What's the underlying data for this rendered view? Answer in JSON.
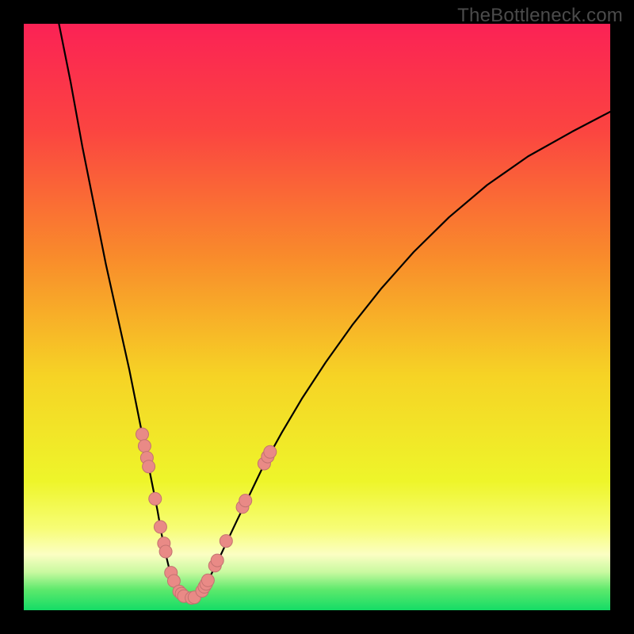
{
  "watermark": "TheBottleneck.com",
  "colors": {
    "frame_bg": "#000000",
    "curve_stroke": "#000000",
    "marker_fill": "#e98a86",
    "marker_stroke": "#c37270",
    "gradient_stops": [
      {
        "offset": 0.0,
        "color": "#fb2255"
      },
      {
        "offset": 0.18,
        "color": "#fb4441"
      },
      {
        "offset": 0.4,
        "color": "#f98c2b"
      },
      {
        "offset": 0.6,
        "color": "#f6d325"
      },
      {
        "offset": 0.78,
        "color": "#eef52a"
      },
      {
        "offset": 0.86,
        "color": "#f7fd75"
      },
      {
        "offset": 0.905,
        "color": "#fbfec3"
      },
      {
        "offset": 0.935,
        "color": "#c9f9a0"
      },
      {
        "offset": 0.965,
        "color": "#5de96c"
      },
      {
        "offset": 1.0,
        "color": "#14dc66"
      }
    ]
  },
  "chart_data": {
    "type": "line",
    "title": "",
    "xlabel": "",
    "ylabel": "",
    "xlim": [
      0,
      100
    ],
    "ylim": [
      0,
      100
    ],
    "grid": false,
    "series": [
      {
        "name": "bottleneck-curve-left",
        "x": [
          6,
          8,
          10,
          12,
          14,
          16,
          18,
          19,
          20,
          21,
          22,
          22.8,
          23.5,
          24.1,
          24.7,
          25.3,
          25.9,
          26.5
        ],
        "y": [
          100,
          90,
          79,
          69,
          59,
          50,
          41,
          36,
          31,
          26,
          21,
          17,
          13,
          10,
          7.5,
          5.5,
          4,
          3
        ]
      },
      {
        "name": "bottleneck-curve-bottom",
        "x": [
          26.5,
          27.2,
          28,
          28.8,
          29.6,
          30.2
        ],
        "y": [
          3,
          2.3,
          2,
          2,
          2.3,
          3
        ]
      },
      {
        "name": "bottleneck-curve-right",
        "x": [
          30.2,
          31,
          32,
          33.2,
          34.6,
          36.4,
          38.6,
          41,
          44,
          47.5,
          51.5,
          56,
          61,
          66.5,
          72.5,
          79,
          86,
          93.5,
          100
        ],
        "y": [
          3,
          4.3,
          6.2,
          8.6,
          11.6,
          15.4,
          19.9,
          24.9,
          30.3,
          36.2,
          42.3,
          48.6,
          54.9,
          61.1,
          67,
          72.5,
          77.4,
          81.6,
          85
        ]
      }
    ],
    "markers": [
      {
        "x": 20.2,
        "y": 30.0
      },
      {
        "x": 20.6,
        "y": 28.0
      },
      {
        "x": 21.0,
        "y": 26.0
      },
      {
        "x": 21.3,
        "y": 24.5
      },
      {
        "x": 22.4,
        "y": 19.0
      },
      {
        "x": 23.3,
        "y": 14.2
      },
      {
        "x": 23.9,
        "y": 11.4
      },
      {
        "x": 24.2,
        "y": 10.0
      },
      {
        "x": 25.1,
        "y": 6.4
      },
      {
        "x": 25.6,
        "y": 5.0
      },
      {
        "x": 26.5,
        "y": 3.2
      },
      {
        "x": 26.9,
        "y": 2.8
      },
      {
        "x": 27.3,
        "y": 2.4
      },
      {
        "x": 28.6,
        "y": 2.1
      },
      {
        "x": 29.1,
        "y": 2.2
      },
      {
        "x": 30.4,
        "y": 3.3
      },
      {
        "x": 30.8,
        "y": 4.0
      },
      {
        "x": 31.1,
        "y": 4.5
      },
      {
        "x": 31.4,
        "y": 5.1
      },
      {
        "x": 32.6,
        "y": 7.6
      },
      {
        "x": 33.0,
        "y": 8.5
      },
      {
        "x": 34.5,
        "y": 11.8
      },
      {
        "x": 37.3,
        "y": 17.6
      },
      {
        "x": 37.8,
        "y": 18.7
      },
      {
        "x": 41.0,
        "y": 25.0
      },
      {
        "x": 41.6,
        "y": 26.2
      },
      {
        "x": 42.0,
        "y": 27.0
      }
    ]
  }
}
